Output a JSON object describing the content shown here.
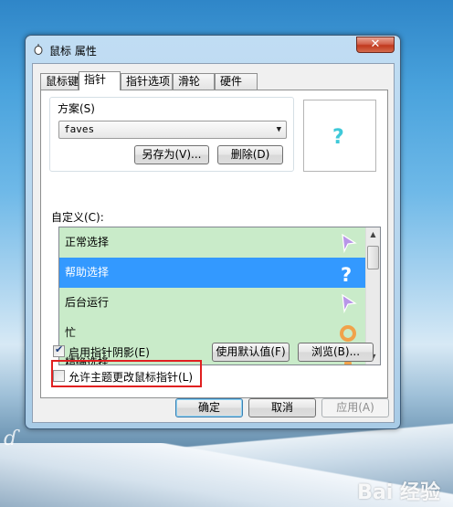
{
  "window": {
    "title": "鼠标 属性",
    "close_label": "✕"
  },
  "tabs": [
    {
      "label": "鼠标键",
      "active": false
    },
    {
      "label": "指针",
      "active": true
    },
    {
      "label": "指针选项",
      "active": false
    },
    {
      "label": "滑轮",
      "active": false
    },
    {
      "label": "硬件",
      "active": false
    }
  ],
  "scheme": {
    "group_label": "方案(S)",
    "selected_value": "faves",
    "save_as_label": "另存为(V)...",
    "delete_label": "删除(D)"
  },
  "preview": {
    "icon": "help-cursor-icon"
  },
  "customize": {
    "label": "自定义(C):",
    "items": [
      {
        "label": "正常选择",
        "icon": "arrow-cursor-icon",
        "selected": false
      },
      {
        "label": "帮助选择",
        "icon": "help-cursor-icon",
        "selected": true
      },
      {
        "label": "后台运行",
        "icon": "arrow-cursor-icon",
        "selected": false
      },
      {
        "label": "忙",
        "icon": "busy-ring-icon",
        "selected": false
      },
      {
        "label": "精确选择",
        "icon": "crosshair-icon",
        "selected": false
      }
    ]
  },
  "options": {
    "shadow_label": "启用指针阴影(E)",
    "shadow_checked": true,
    "use_default_label": "使用默认值(F)",
    "browse_label": "浏览(B)...",
    "allow_theme_label": "允许主题更改鼠标指针(L)",
    "allow_theme_checked": false
  },
  "footer": {
    "ok_label": "确定",
    "cancel_label": "取消",
    "apply_label": "应用(A)"
  },
  "watermark": "Bai 经验",
  "colors": {
    "selection": "#3399ff",
    "list_bg": "#c9ebc9",
    "highlight_box": "#e02020",
    "cursor_purple": "#b896e8",
    "cursor_cyan": "#3fc9d9",
    "busy_orange": "#f1a24a"
  }
}
